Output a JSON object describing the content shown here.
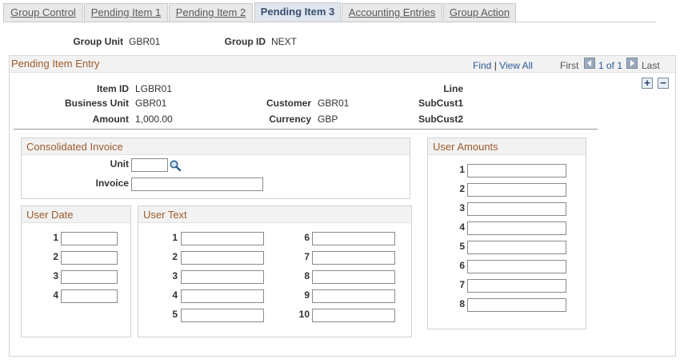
{
  "tabs": [
    {
      "label": "Group Control",
      "active": false
    },
    {
      "label": "Pending Item 1",
      "active": false
    },
    {
      "label": "Pending Item 2",
      "active": false
    },
    {
      "label": "Pending Item 3",
      "active": true
    },
    {
      "label": "Accounting Entries",
      "active": false
    },
    {
      "label": "Group Action",
      "active": false
    }
  ],
  "header": {
    "group_unit_label": "Group Unit",
    "group_unit_value": "GBR01",
    "group_id_label": "Group ID",
    "group_id_value": "NEXT"
  },
  "pending_item": {
    "title": "Pending Item Entry",
    "find": "Find",
    "sep": "|",
    "view_all": "View All",
    "first": "First",
    "page_info": "1 of 1",
    "last": "Last",
    "item_id_label": "Item ID",
    "item_id_value": "LGBR01",
    "business_unit_label": "Business Unit",
    "business_unit_value": "GBR01",
    "amount_label": "Amount",
    "amount_value": "1,000.00",
    "customer_label": "Customer",
    "customer_value": "GBR01",
    "currency_label": "Currency",
    "currency_value": "GBP",
    "line_label": "Line",
    "subcust1_label": "SubCust1",
    "subcust2_label": "SubCust2",
    "add_symbol": "+",
    "remove_symbol": "−"
  },
  "consolidated_invoice": {
    "title": "Consolidated Invoice",
    "unit_label": "Unit",
    "unit_value": "",
    "invoice_label": "Invoice",
    "invoice_value": ""
  },
  "user_date": {
    "title": "User Date",
    "fields": [
      "1",
      "2",
      "3",
      "4"
    ]
  },
  "user_text": {
    "title": "User Text",
    "fields_left": [
      "1",
      "2",
      "3",
      "4",
      "5"
    ],
    "fields_right": [
      "6",
      "7",
      "8",
      "9",
      "10"
    ]
  },
  "user_amounts": {
    "title": "User Amounts",
    "fields": [
      "1",
      "2",
      "3",
      "4",
      "5",
      "6",
      "7",
      "8"
    ]
  },
  "colors": {
    "section_title": "#9c5a2a",
    "link": "#2a5a9a",
    "active_tab_text": "#3a4f6e"
  }
}
